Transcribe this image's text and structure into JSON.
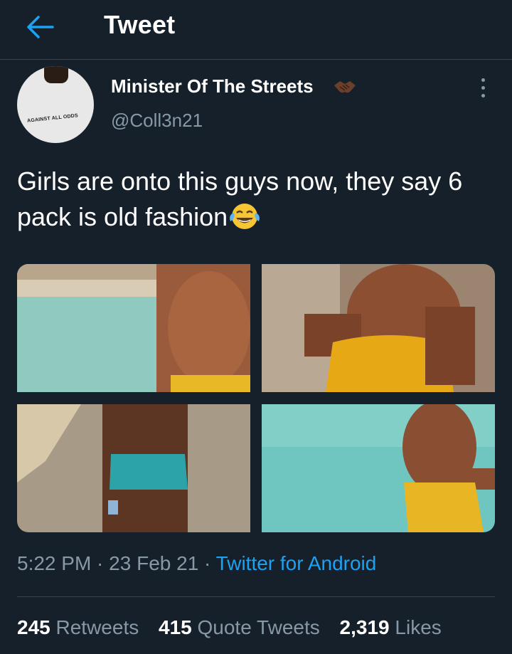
{
  "header": {
    "title": "Tweet",
    "back_icon": "arrow-left-icon",
    "accent": "#1da1f2"
  },
  "author": {
    "display_name": "Minister Of The Streets",
    "name_emoji": "handshake-icon",
    "handle": "@Coll3n21",
    "avatar_shirt_text": "AGAINST ALL ODDS"
  },
  "tweet": {
    "text": "Girls are onto this guys now, they say 6 pack is old fashion",
    "emoji": "face-with-tears-of-joy-icon"
  },
  "media": [
    {
      "alt": "beach-photo-1"
    },
    {
      "alt": "beach-photo-2"
    },
    {
      "alt": "beach-photo-3"
    },
    {
      "alt": "beach-photo-4"
    }
  ],
  "meta": {
    "time": "5:22 PM",
    "sep1": " · ",
    "date": "23 Feb 21",
    "sep2": " · ",
    "source": "Twitter for Android"
  },
  "stats": {
    "retweets_count": "245",
    "retweets_label": "Retweets",
    "quotes_count": "415",
    "quotes_label": "Quote Tweets",
    "likes_count": "2,319",
    "likes_label": "Likes"
  },
  "colors": {
    "background": "#15202b",
    "secondary_text": "#8899a6",
    "link": "#1da1f2",
    "divider": "#38444d"
  }
}
